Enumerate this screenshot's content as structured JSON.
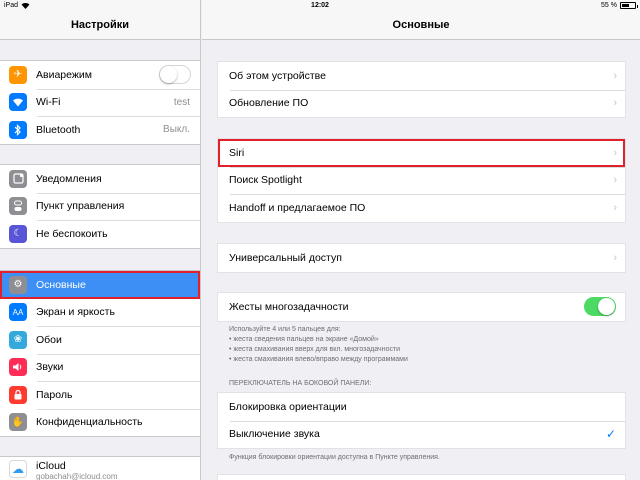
{
  "status": {
    "device": "iPad",
    "time": "12:02",
    "battery": "55 %",
    "battery_level": 0.55
  },
  "sidebar": {
    "title": "Настройки",
    "group1": [
      {
        "label": "Авиарежим",
        "icon": "airplane-icon",
        "color": "#ff9500",
        "toggle": false
      },
      {
        "label": "Wi-Fi",
        "icon": "wifi-icon",
        "color": "#007aff",
        "value": "test"
      },
      {
        "label": "Bluetooth",
        "icon": "bluetooth-icon",
        "color": "#007aff",
        "value": "Выкл."
      }
    ],
    "group2": [
      {
        "label": "Уведомления",
        "icon": "notifications-icon",
        "color": "#8e8e93"
      },
      {
        "label": "Пункт управления",
        "icon": "control-center-icon",
        "color": "#8e8e93"
      },
      {
        "label": "Не беспокоить",
        "icon": "moon-icon",
        "color": "#5856d6"
      }
    ],
    "group3": [
      {
        "label": "Основные",
        "icon": "gear-icon",
        "color": "#8e8e93",
        "selected": true
      },
      {
        "label": "Экран и яркость",
        "icon": "display-icon",
        "color": "#007aff"
      },
      {
        "label": "Обои",
        "icon": "wallpaper-icon",
        "color": "#34aadc"
      },
      {
        "label": "Звуки",
        "icon": "sounds-icon",
        "color": "#ff2d55"
      },
      {
        "label": "Пароль",
        "icon": "passcode-icon",
        "color": "#ff3b30"
      },
      {
        "label": "Конфиденциальность",
        "icon": "privacy-icon",
        "color": "#8e8e93"
      }
    ],
    "icloud": {
      "label": "iCloud",
      "sub": "gobachah@icloud.com"
    }
  },
  "main": {
    "title": "Основные",
    "group1": [
      {
        "label": "Об этом устройстве"
      },
      {
        "label": "Обновление ПО"
      }
    ],
    "group2": [
      {
        "label": "Siri",
        "highlight": true
      },
      {
        "label": "Поиск Spotlight"
      },
      {
        "label": "Handoff и предлагаемое ПО"
      }
    ],
    "group3": [
      {
        "label": "Универсальный доступ"
      }
    ],
    "multitasking": {
      "label": "Жесты многозадачности",
      "toggle": true
    },
    "multitasking_note": [
      "Используйте 4 или 5 пальцев для:",
      "• жеста сведения пальцев на экране «Домой»",
      "• жеста смахивания вверх для вкл. многозадачности",
      "• жеста смахивания влево/вправо между программами"
    ],
    "side_switch_header": "ПЕРЕКЛЮЧАТЕЛЬ НА БОКОВОЙ ПАНЕЛИ:",
    "side_switch": [
      {
        "label": "Блокировка ориентации"
      },
      {
        "label": "Выключение звука",
        "checked": true
      }
    ],
    "side_switch_note": "Функция блокировки ориентации доступна в Пункте управления."
  }
}
